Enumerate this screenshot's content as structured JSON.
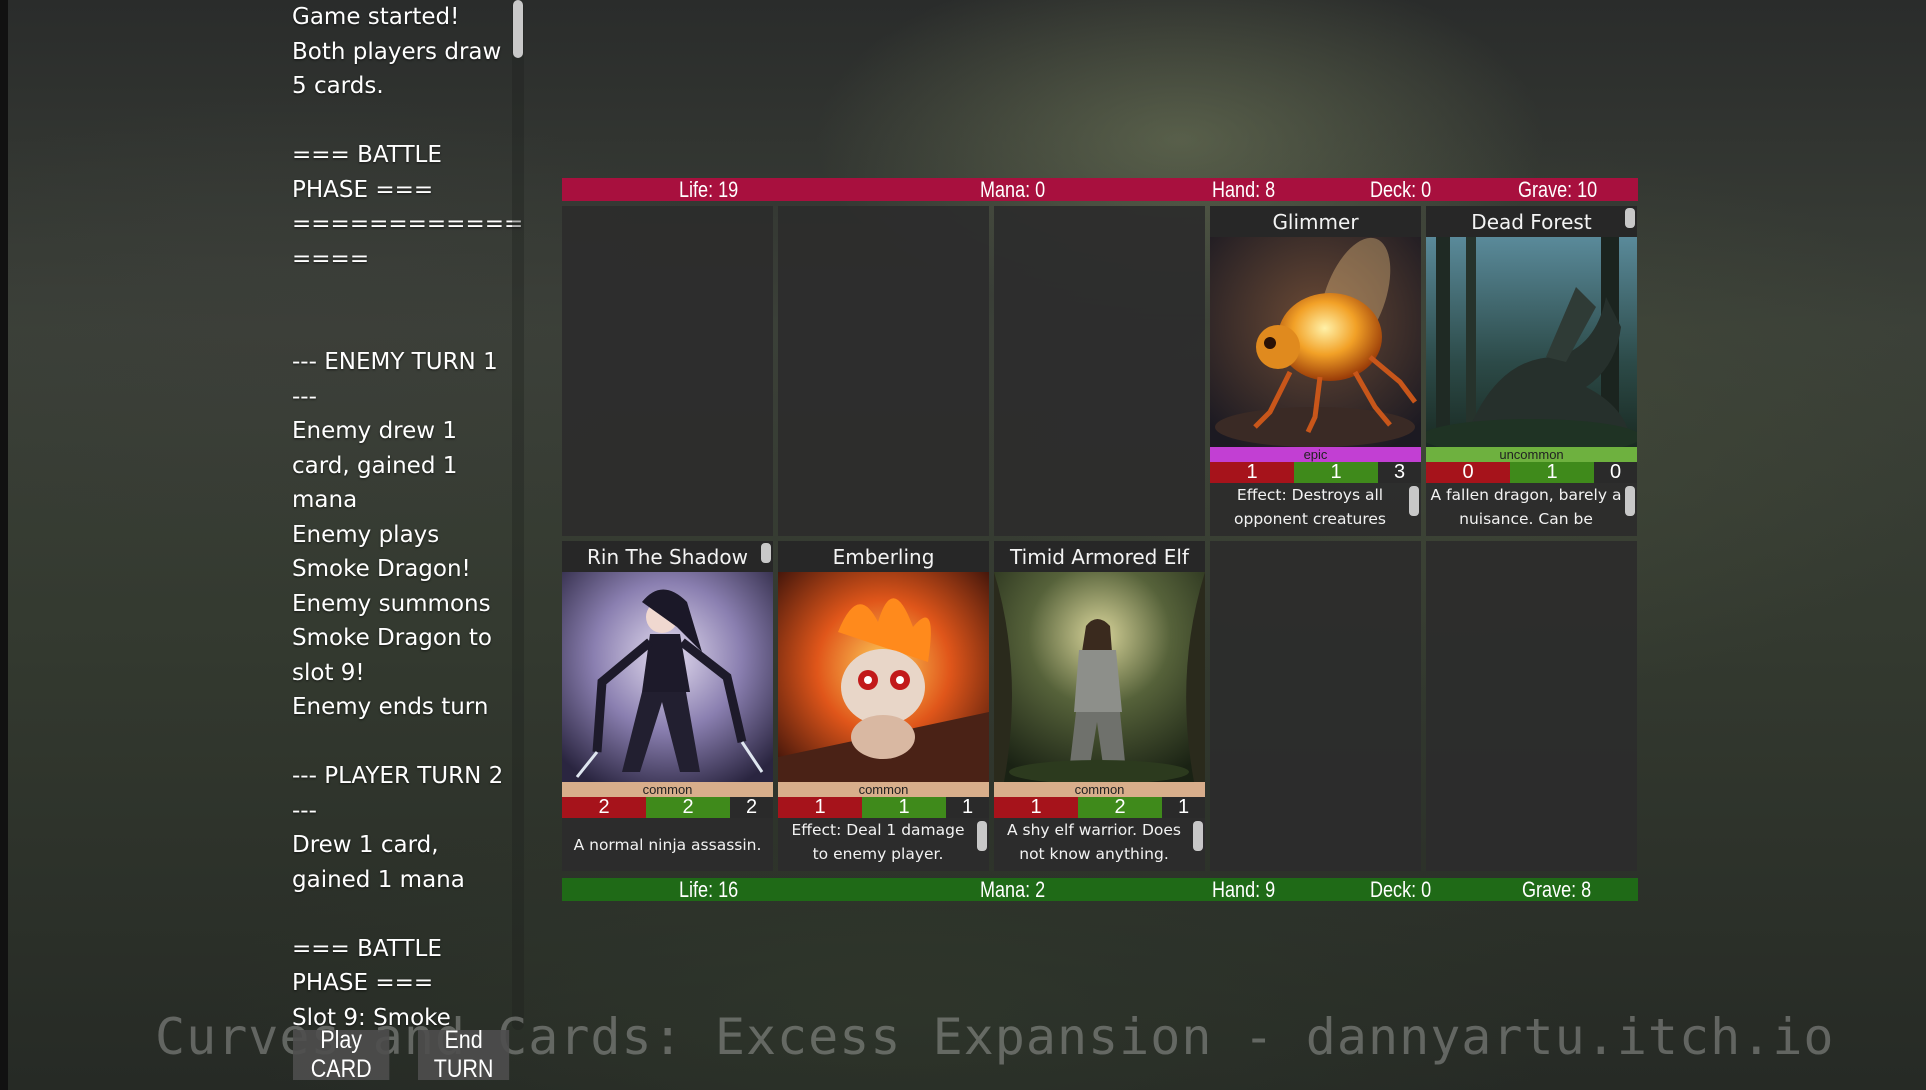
{
  "log": {
    "text": "Game started!\nBoth players draw\n5 cards.\n\n=== BATTLE\nPHASE ===\n===============\n====\n\n\n--- ENEMY TURN 1\n---\nEnemy drew 1\ncard, gained 1\nmana\nEnemy plays\nSmoke Dragon!\nEnemy summons\nSmoke Dragon to\nslot 9!\nEnemy ends turn\n\n--- PLAYER TURN 2\n---\nDrew 1 card,\ngained 1 mana\n\n=== BATTLE\nPHASE ===\nSlot 9: Smoke"
  },
  "buttons": {
    "play_card": "Play CARD",
    "end_turn": "End TURN"
  },
  "watermark": "Curves and Cards: Excess Expansion - dannyartu.itch.io",
  "enemy": {
    "life": "Life: 19",
    "mana": "Mana: 0",
    "hand": "Hand: 8",
    "deck": "Deck: 0",
    "grave": "Grave: 10"
  },
  "player": {
    "life": "Life: 16",
    "mana": "Mana: 2",
    "hand": "Hand: 9",
    "deck": "Deck: 0",
    "grave": "Grave: 8"
  },
  "enemy_cards": [
    {
      "name": "Glimmer",
      "rarity": "epic",
      "attack": "1",
      "cost": "1",
      "health": "3",
      "description": "Effect: Destroys all opponent creatures",
      "art_icon": "glowing-insect-art"
    },
    {
      "name": "Dead Forest",
      "rarity": "uncommon",
      "attack": "0",
      "cost": "1",
      "health": "0",
      "description": "A fallen dragon, barely a nuisance. Can be",
      "art_icon": "forest-dragon-art"
    }
  ],
  "player_cards": [
    {
      "name": "Rin The Shadow",
      "rarity": "common",
      "attack": "2",
      "cost": "2",
      "health": "2",
      "description": "A normal ninja assassin.",
      "art_icon": "ninja-art"
    },
    {
      "name": "Emberling",
      "rarity": "common",
      "attack": "1",
      "cost": "1",
      "health": "1",
      "description": "Effect: Deal 1 damage to enemy player.",
      "art_icon": "fire-creature-art"
    },
    {
      "name": "Timid Armored Elf",
      "rarity": "common",
      "attack": "1",
      "cost": "2",
      "health": "1",
      "description": "A shy elf warrior. Does not know anything.",
      "art_icon": "elf-warrior-art"
    }
  ],
  "colors": {
    "enemy_bar": "#a8103e",
    "player_bar": "#1f6a17",
    "epic": "#c23fd3",
    "uncommon": "#6eb13f",
    "common": "#d8ae8b",
    "attack": "#a6131b",
    "cost": "#3f8a1b"
  }
}
